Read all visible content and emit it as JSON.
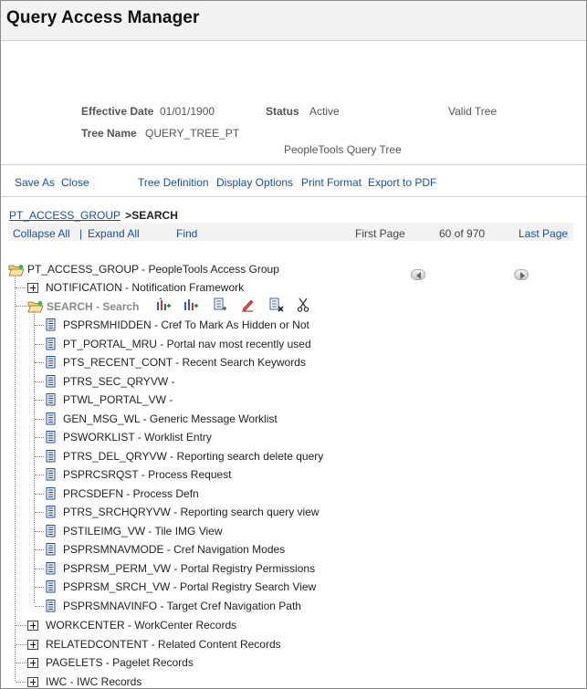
{
  "page": {
    "title": "Query Access Manager"
  },
  "info": {
    "effective_date_label": "Effective Date",
    "effective_date_value": "01/01/1900",
    "status_label": "Status",
    "status_value": "Active",
    "valid_tree": "Valid Tree",
    "tree_name_label": "Tree Name",
    "tree_name_value": "QUERY_TREE_PT",
    "tree_description": "PeopleTools Query Tree"
  },
  "actions": {
    "save_as": "Save As",
    "close": "Close",
    "tree_definition": "Tree Definition",
    "display_options": "Display Options",
    "print_format": "Print Format",
    "export_pdf": "Export to PDF"
  },
  "breadcrumb": {
    "root": "PT_ACCESS_GROUP",
    "separator": ">",
    "current": "SEARCH"
  },
  "navbar": {
    "collapse_all": "Collapse All",
    "divider": "|",
    "expand_all": "Expand All",
    "find": "Find",
    "first_page": "First Page",
    "page_count": "60 of 970",
    "last_page": "Last Page"
  },
  "tree": {
    "root": "PT_ACCESS_GROUP - PeopleTools Access Group",
    "notification": "NOTIFICATION - Notification Framework",
    "search": "SEARCH - Search",
    "records": [
      "PSPRSMHIDDEN - Cref To Mark As Hidden or Not",
      "PT_PORTAL_MRU - Portal nav most recently used",
      "PTS_RECENT_CONT - Recent Search Keywords",
      "PTRS_SEC_QRYVW -",
      "PTWL_PORTAL_VW -",
      "GEN_MSG_WL - Generic Message Worklist",
      "PSWORKLIST - Worklist Entry",
      "PTRS_DEL_QRYVW - Reporting search delete query",
      "PSPRCSRQST - Process Request",
      "PRCSDEFN - Process Defn",
      "PTRS_SRCHQRYVW - Reporting search query view",
      "PSTILEIMG_VW - Tile IMG View",
      "PSPRSMNAVMODE - Cref Navigation Modes",
      "PSPRSM_PERM_VW - Portal Registry Permissions",
      "PSPRSM_SRCH_VW - Portal Registry Search View",
      "PSPRSMNAVINFO - Target Cref Navigation Path"
    ],
    "groups": [
      "WORKCENTER - WorkCenter Records",
      "RELATEDCONTENT - Related Content Records",
      "PAGELETS - Pagelet Records",
      "IWC - IWC Records"
    ]
  }
}
